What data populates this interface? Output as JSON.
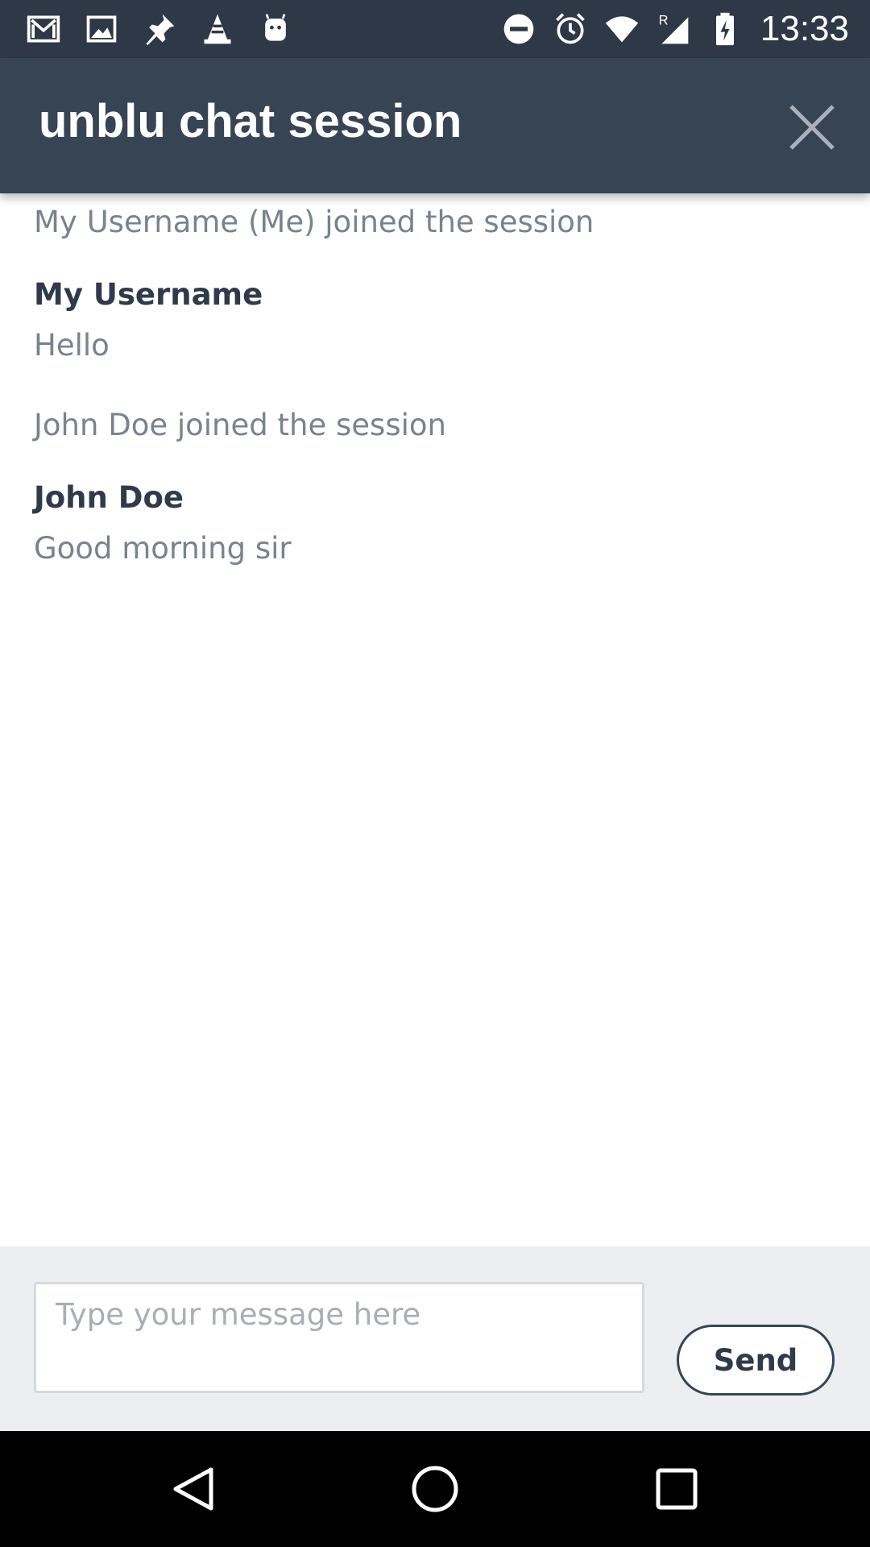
{
  "status_bar": {
    "time": "13:33",
    "left_icons": [
      "gmail-icon",
      "gallery-icon",
      "pin-icon",
      "vlc-icon",
      "android-icon"
    ],
    "right_icons": [
      "do-not-disturb-icon",
      "alarm-icon",
      "wifi-icon",
      "signal-roaming-icon",
      "battery-charging-icon"
    ]
  },
  "toolbar": {
    "title": "unblu chat session",
    "close_icon": "close-icon"
  },
  "messages": [
    {
      "type": "system",
      "text": "My Username (Me) joined the session"
    },
    {
      "type": "message",
      "author": "My Username",
      "text": "Hello"
    },
    {
      "type": "system",
      "text": "John Doe joined the session"
    },
    {
      "type": "message",
      "author": "John Doe",
      "text": "Good morning sir"
    }
  ],
  "composer": {
    "placeholder": "Type your message here",
    "value": "",
    "send_label": "Send"
  },
  "nav_bar": {
    "buttons": [
      "back-icon",
      "home-icon",
      "recents-icon"
    ]
  },
  "colors": {
    "status_bar": "#2e3847",
    "toolbar": "#374454",
    "composer_bg": "#eceef2",
    "author_text": "#2f3a4a",
    "muted_text": "#7a8290"
  }
}
